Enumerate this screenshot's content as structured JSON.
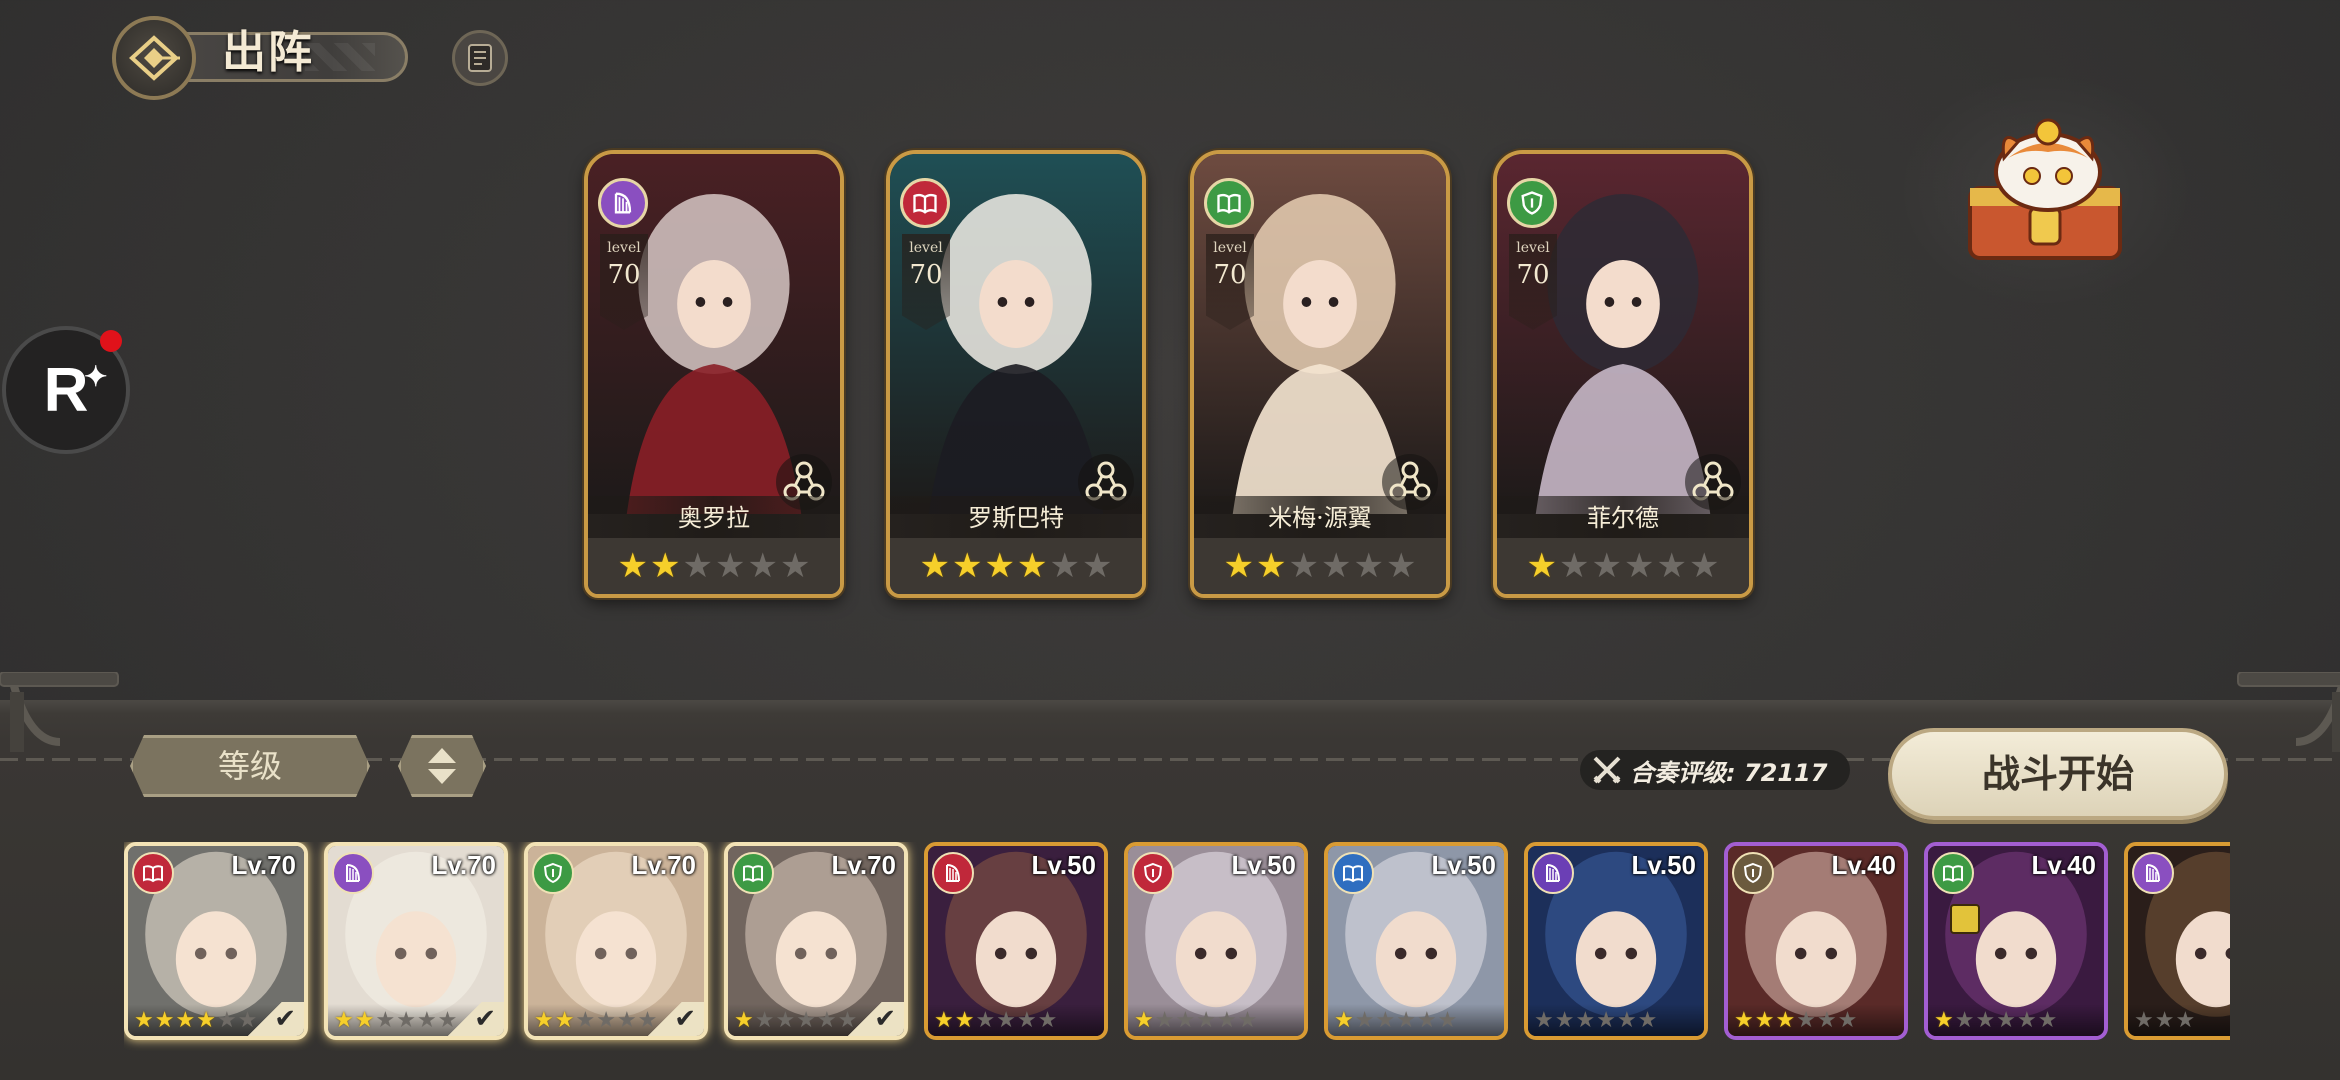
{
  "header": {
    "title": "出阵",
    "back_icon": "back-emblem-icon",
    "log_icon": "scroll-log-icon"
  },
  "side": {
    "r_button": "R",
    "notification": true
  },
  "formation": [
    {
      "name": "奥罗拉",
      "level_word": "level",
      "level": "70",
      "class": "harp",
      "class_color": "#8a4fc0",
      "stars": 2,
      "art": [
        "#4a2024",
        "#d6c7c4",
        "#8a1f27"
      ]
    },
    {
      "name": "罗斯巴特",
      "level_word": "level",
      "level": "70",
      "class": "book",
      "class_color": "#c0283a",
      "stars": 4,
      "art": [
        "#1f4f55",
        "#f1ede6",
        "#1c1c22"
      ]
    },
    {
      "name": "米梅·源翼",
      "level_word": "level",
      "level": "70",
      "class": "book",
      "class_color": "#3d9a44",
      "stars": 2,
      "art": [
        "#6e4b40",
        "#e8cfb4",
        "#f5e6d2"
      ]
    },
    {
      "name": "菲尔德",
      "level_word": "level",
      "level": "70",
      "class": "shield",
      "class_color": "#3d9a44",
      "stars": 1,
      "art": [
        "#5a2630",
        "#2e2a35",
        "#c7b7c6"
      ]
    }
  ],
  "controls": {
    "sort_label": "等级",
    "order_icon": "sort-updown-icon",
    "rating_label": "合奏评级: 72117",
    "start_label": "战斗开始"
  },
  "roster": [
    {
      "level": "Lv.70",
      "class_color": "#c0283a",
      "stars": 4,
      "selected": true,
      "frame": "gold",
      "tone": [
        "#3a3d42",
        "#e9e2d8"
      ]
    },
    {
      "level": "Lv.70",
      "class_color": "#8a4fc0",
      "stars": 2,
      "selected": true,
      "frame": "gold",
      "tone": [
        "#d8d3cf",
        "#f4f0ec"
      ]
    },
    {
      "level": "Lv.70",
      "class_color": "#3d9a44",
      "stars": 2,
      "selected": true,
      "frame": "gold",
      "tone": [
        "#b89a80",
        "#f0e0cc"
      ]
    },
    {
      "level": "Lv.70",
      "class_color": "#3d9a44",
      "stars": 1,
      "selected": true,
      "frame": "gold",
      "tone": [
        "#3b2e2e",
        "#d4c0b6"
      ]
    },
    {
      "level": "Lv.50",
      "class_color": "#c0283a",
      "stars": 2,
      "selected": false,
      "frame": "gold",
      "tone": [
        "#3a1f3e",
        "#8c5a44"
      ]
    },
    {
      "level": "Lv.50",
      "class_color": "#c0283a",
      "stars": 1,
      "selected": false,
      "frame": "gold",
      "tone": [
        "#9a8e98",
        "#ece6ee"
      ]
    },
    {
      "level": "Lv.50",
      "class_color": "#2f6ec0",
      "stars": 1,
      "selected": false,
      "frame": "gold",
      "tone": [
        "#8e97a8",
        "#e6e4ea"
      ]
    },
    {
      "level": "Lv.50",
      "class_color": "#6b3fb5",
      "stars": 0,
      "selected": false,
      "frame": "gold",
      "tone": [
        "#1c2f5a",
        "#3d5ea0"
      ]
    },
    {
      "level": "Lv.40",
      "class_color": "#6b5a3e",
      "stars": 3,
      "selected": false,
      "frame": "purple",
      "tone": [
        "#5a2a28",
        "#e2c0b4"
      ]
    },
    {
      "level": "Lv.40",
      "class_color": "#3d9a44",
      "stars": 1,
      "selected": false,
      "frame": "purple",
      "tone": [
        "#3a1a40",
        "#7a3c80"
      ]
    },
    {
      "level": "",
      "class_color": "#8a4fc0",
      "stars": 0,
      "selected": false,
      "frame": "gold",
      "tone": [
        "#2a1e1a",
        "#7a5a3c"
      ]
    }
  ],
  "colors": {
    "accent_gold": "#c99a45",
    "star_on": "#f6cf2a",
    "star_off": "#6f6b66",
    "background": "#363534"
  }
}
